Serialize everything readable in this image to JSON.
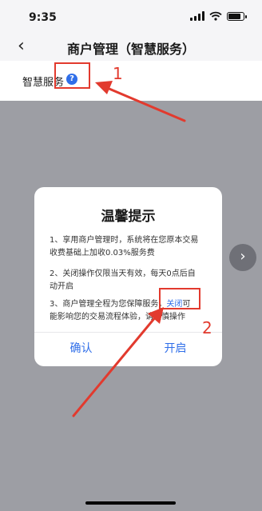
{
  "status_bar": {
    "time": "9:35"
  },
  "nav": {
    "back_glyph": "‹",
    "title": "商户管理（智慧服务）"
  },
  "settings": {
    "service_label": "智慧服务",
    "help_glyph": "?"
  },
  "dialog": {
    "title": "温馨提示",
    "lines": [
      "1、享用商户管理时，系统将在您原本交易",
      "收费基础上加收0.03%服务费",
      "2、关闭操作仅限当天有效，每天0点后自",
      "动开启",
      "3、商户管理全程为您保障服务，",
      "关闭",
      "可",
      "能影响您的交易流程体验，请谨慎操作"
    ],
    "confirm_label": "确认",
    "open_label": "开启"
  },
  "side_button": {
    "glyph": "›"
  },
  "annotations": {
    "label_1": "1",
    "label_2": "2"
  },
  "colors": {
    "accent": "#2f6ee9",
    "annotation_red": "#e23a2e",
    "overlay": "#9d9ea4"
  }
}
